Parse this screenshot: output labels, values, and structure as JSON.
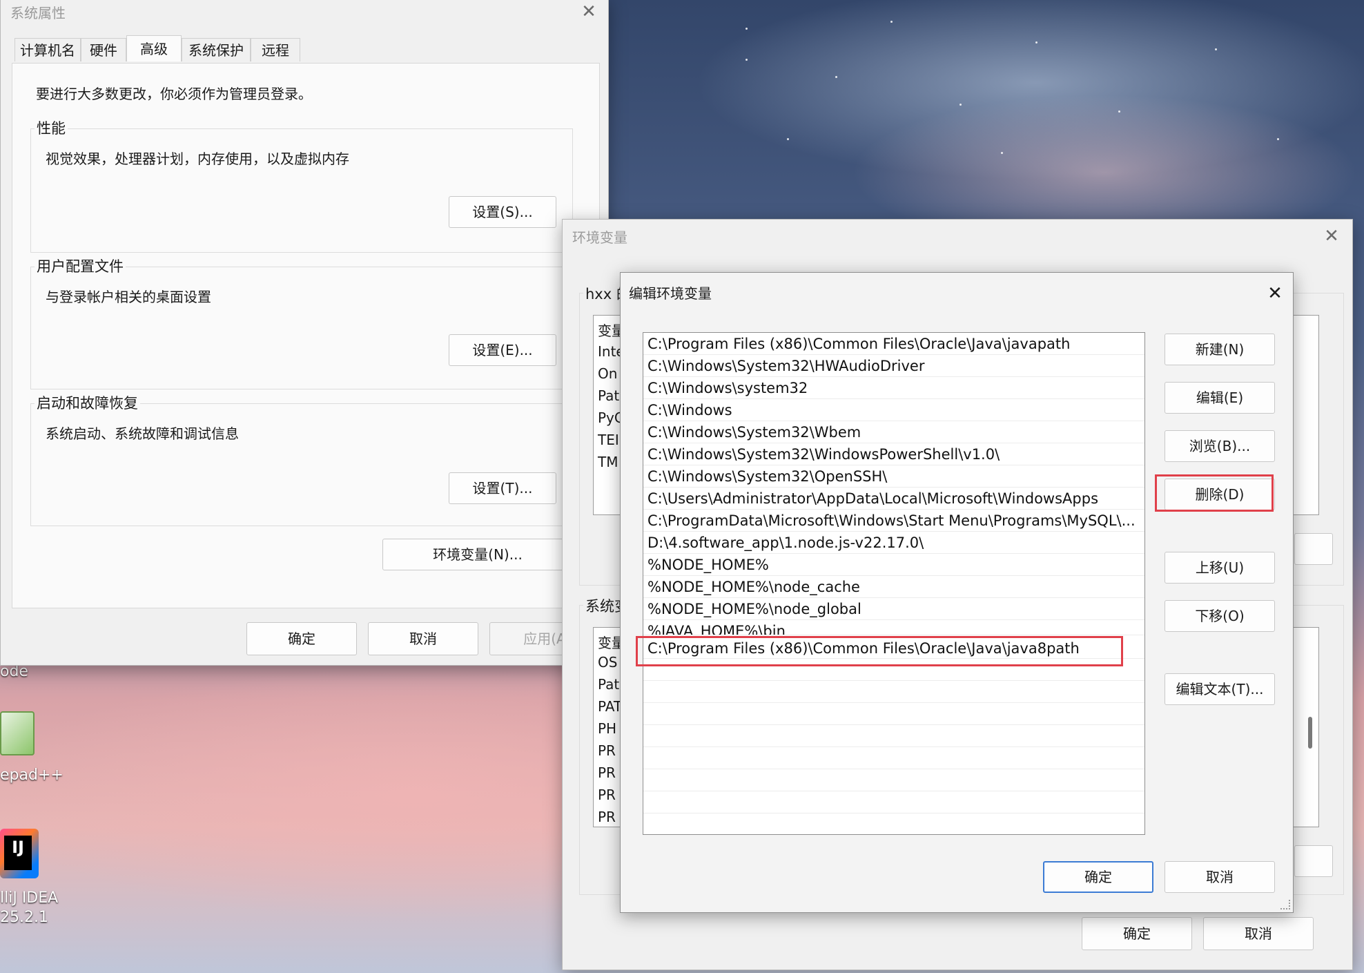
{
  "desktop": {
    "icons": [
      {
        "label": "ode"
      },
      {
        "label": "epad++"
      },
      {
        "label": "lliJ IDEA"
      },
      {
        "label": "25.2.1"
      }
    ],
    "idea_glyph": "IJ"
  },
  "sys_props": {
    "title": "系统属性",
    "close": "✕",
    "tabs": [
      "计算机名",
      "硬件",
      "高级",
      "系统保护",
      "远程"
    ],
    "admin_note": "要进行大多数更改，你必须作为管理员登录。",
    "performance": {
      "label": "性能",
      "desc": "视觉效果，处理器计划，内存使用，以及虚拟内存",
      "button": "设置(S)..."
    },
    "user_profile": {
      "label": "用户配置文件",
      "desc": "与登录帐户相关的桌面设置",
      "button": "设置(E)..."
    },
    "startup": {
      "label": "启动和故障恢复",
      "desc": "系统启动、系统故障和调试信息",
      "button": "设置(T)..."
    },
    "env_button": "环境变量(N)...",
    "ok": "确定",
    "cancel": "取消",
    "apply": "应用(A"
  },
  "env_vars": {
    "title": "环境变量",
    "close": "✕",
    "user_group": "hxx 的",
    "user_col": "变量",
    "user_rows": [
      "Inte",
      "On",
      "Pat",
      "PyC",
      "TEI",
      "TM"
    ],
    "sys_group": "系统变",
    "sys_col": "变量",
    "sys_rows": [
      "OS",
      "Pat",
      "PAT",
      "PH",
      "PR",
      "PR",
      "PR",
      "PR"
    ],
    "ok": "确定",
    "cancel": "取消"
  },
  "edit_env": {
    "title": "编辑环境变量",
    "close": "✕",
    "paths": [
      "C:\\Program Files (x86)\\Common Files\\Oracle\\Java\\javapath",
      "C:\\Windows\\System32\\HWAudioDriver",
      "C:\\Windows\\system32",
      "C:\\Windows",
      "C:\\Windows\\System32\\Wbem",
      "C:\\Windows\\System32\\WindowsPowerShell\\v1.0\\",
      "C:\\Windows\\System32\\OpenSSH\\",
      "C:\\Users\\Administrator\\AppData\\Local\\Microsoft\\WindowsApps",
      "C:\\ProgramData\\Microsoft\\Windows\\Start Menu\\Programs\\MySQL\\...",
      "D:\\4.software_app\\1.node.js-v22.17.0\\",
      "%NODE_HOME%",
      "%NODE_HOME%\\node_cache",
      "%NODE_HOME%\\node_global",
      "%JAVA_HOME%\\bin",
      "C:\\Program Files (x86)\\Common Files\\Oracle\\Java\\java8path"
    ],
    "buttons": {
      "new": "新建(N)",
      "edit": "编辑(E)",
      "browse": "浏览(B)...",
      "delete": "删除(D)",
      "up": "上移(U)",
      "down": "下移(O)",
      "edit_text": "编辑文本(T)..."
    },
    "ok": "确定",
    "cancel": "取消",
    "highlight_color": "#e0404a"
  }
}
